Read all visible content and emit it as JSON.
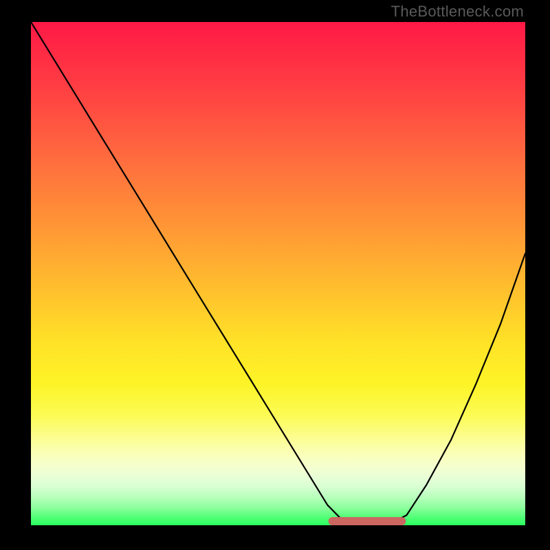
{
  "attribution": {
    "text": "TheBottleneck.com"
  },
  "colors": {
    "background": "#000000",
    "curve": "#000000",
    "valley_marker": "#cc6661",
    "gradient_top": "#ff1946",
    "gradient_bottom": "#28ff5f"
  },
  "chart_data": {
    "type": "line",
    "title": "",
    "xlabel": "",
    "ylabel": "",
    "xlim": [
      0,
      100
    ],
    "ylim": [
      0,
      100
    ],
    "grid": false,
    "legend": false,
    "description": "Bottleneck-style V-curve. Y is mismatch (100 = worst at top, 0 = best at the green bottom). Optimal region is where the curve touches the floor, highlighted by the red marker.",
    "series": [
      {
        "name": "bottleneck_curve",
        "x": [
          0,
          5,
          10,
          15,
          20,
          25,
          30,
          35,
          40,
          45,
          50,
          55,
          60,
          64,
          68,
          72,
          76,
          80,
          85,
          90,
          95,
          100
        ],
        "y": [
          100,
          92,
          84,
          76,
          68,
          60,
          52,
          44,
          36,
          28,
          20,
          12,
          4,
          0,
          0,
          0,
          2,
          8,
          17,
          28,
          40,
          54
        ]
      }
    ],
    "optimal_range": {
      "x_start": 61,
      "x_end": 75,
      "y": 0.8
    }
  }
}
